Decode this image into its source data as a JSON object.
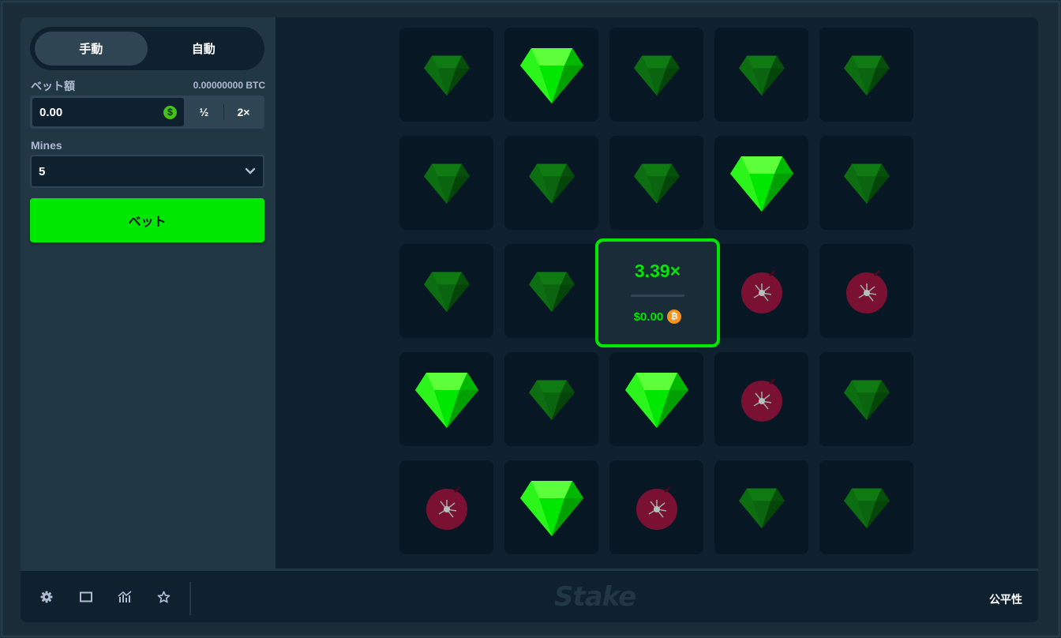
{
  "sidebar": {
    "modes": [
      {
        "label": "手動",
        "active": true
      },
      {
        "label": "自動",
        "active": false
      }
    ],
    "bet_label": "ベット額",
    "bet_balance": "0.00000000 BTC",
    "bet_value": "0.00",
    "currency_symbol": "$",
    "half_label": "½",
    "double_label": "2×",
    "mines_label": "Mines",
    "mines_value": "5",
    "bet_button": "ベット"
  },
  "grid": {
    "columns": 5,
    "rows": 5,
    "tiles": [
      "gem-dim",
      "gem-bright",
      "gem-dim",
      "gem-dim",
      "gem-dim",
      "gem-dim",
      "gem-dim",
      "gem-dim",
      "gem-bright",
      "gem-dim",
      "gem-dim",
      "gem-dim",
      "hidden",
      "mine",
      "mine",
      "gem-bright",
      "gem-dim",
      "gem-bright",
      "mine",
      "gem-dim",
      "mine",
      "gem-bright",
      "mine",
      "gem-dim",
      "gem-dim"
    ]
  },
  "win": {
    "multiplier": "3.39×",
    "amount": "$0.00",
    "coin_symbol": "₿"
  },
  "footer": {
    "icons": [
      "gear-icon",
      "window-icon",
      "stats-icon",
      "star-icon"
    ],
    "logo": "Stake",
    "fairness": "公平性"
  },
  "colors": {
    "accent": "#00e701",
    "panel": "#213743",
    "background": "#0f212e",
    "mine": "#7a1032"
  }
}
